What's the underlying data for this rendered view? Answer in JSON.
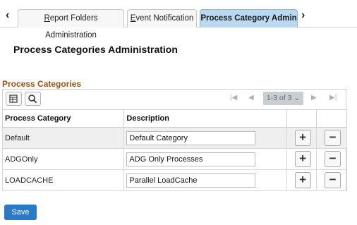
{
  "tabs": [
    {
      "label_ul": "R",
      "label_rest": "eport Folders Administration"
    },
    {
      "label_ul": "E",
      "label_rest": "vent Notification"
    },
    {
      "label": "Process Category Admin"
    }
  ],
  "page": {
    "title": "Process Categories Administration"
  },
  "grid": {
    "title": "Process Categories",
    "row_count": "1-3 of 3",
    "columns": [
      "Process Category",
      "Description"
    ],
    "rows": [
      {
        "category": "Default",
        "description": "Default Category"
      },
      {
        "category": "ADGOnly",
        "description": "ADG Only Processes"
      },
      {
        "category": "LOADCACHE",
        "description": "Parallel LoadCache"
      }
    ]
  },
  "buttons": {
    "add": "+",
    "delete": "−",
    "save": "Save"
  },
  "icons": {
    "prev_tab": "chevron-left-icon",
    "next_tab": "chevron-right-icon",
    "personalize": "personalize-grid-icon",
    "find": "search-icon",
    "first": "first-page-icon",
    "previous": "previous-page-icon",
    "next": "next-page-icon",
    "last": "last-page-icon",
    "dropdown": "chevron-down-icon"
  },
  "colors": {
    "active_tab": "#b9d8f2",
    "grid_title": "#a0500a",
    "save_button": "#2a7ac7"
  }
}
